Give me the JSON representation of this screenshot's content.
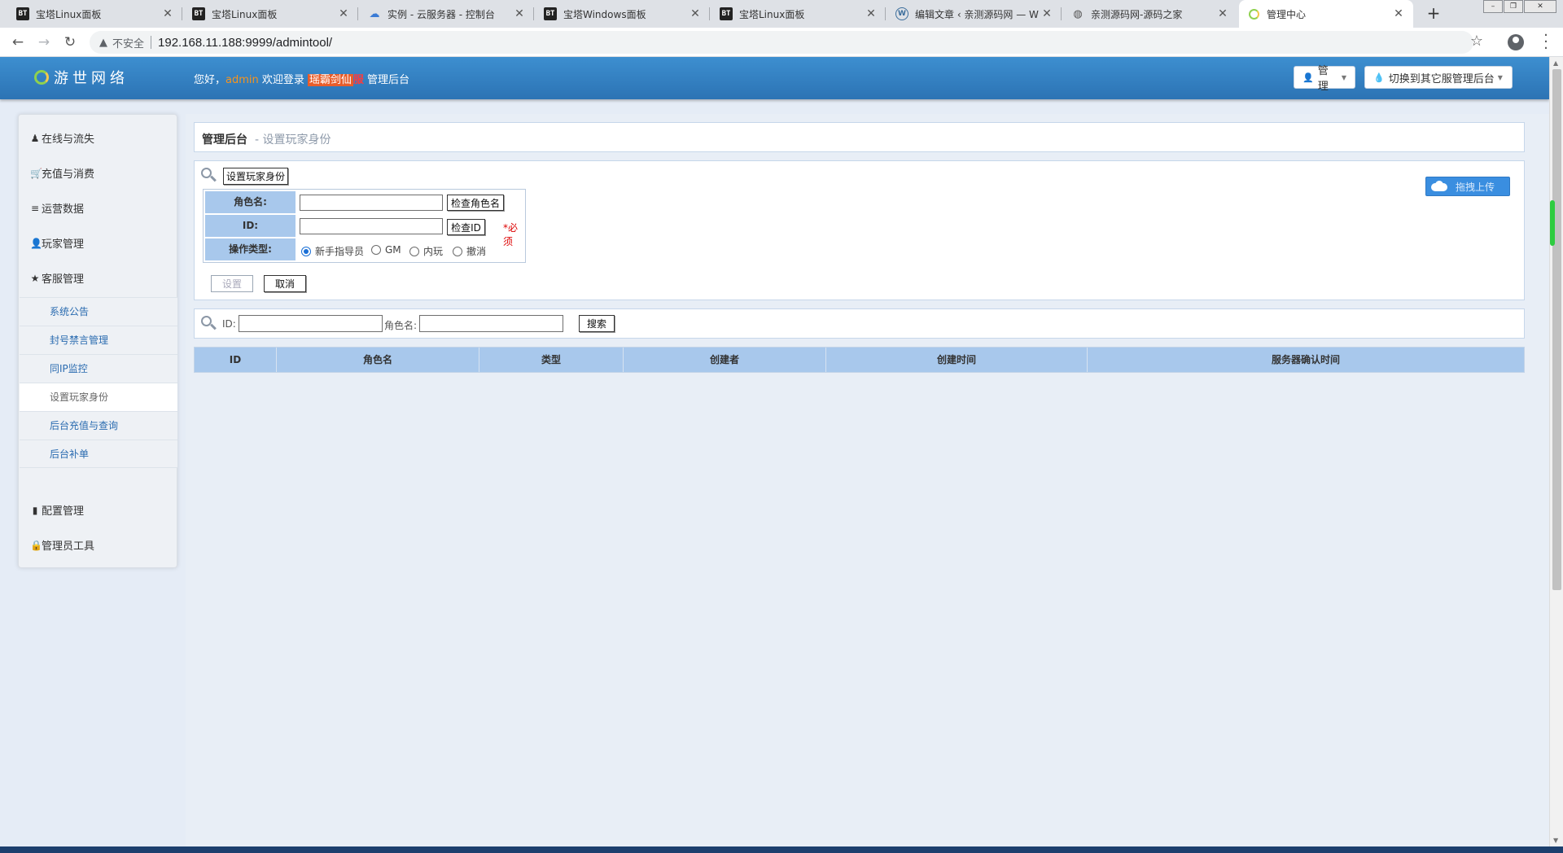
{
  "browser": {
    "tabs": [
      {
        "icon": "BT",
        "title": "宝塔Linux面板"
      },
      {
        "icon": "BT",
        "title": "宝塔Linux面板"
      },
      {
        "icon": "cloud",
        "title": "实例 - 云服务器 - 控制台"
      },
      {
        "icon": "BT",
        "title": "宝塔Windows面板"
      },
      {
        "icon": "BT",
        "title": "宝塔Linux面板"
      },
      {
        "icon": "wordpress",
        "title": "编辑文章 ‹ 亲测源码网 — W"
      },
      {
        "icon": "globe",
        "title": "亲测源码网-源码之家"
      },
      {
        "icon": "loading",
        "title": "管理中心"
      }
    ],
    "security_label": "不安全",
    "url": "192.168.11.188:9999/admintool/"
  },
  "header": {
    "logo": "游世网络",
    "greeting": "您好，",
    "username": "admin",
    "welcome": "欢迎登录",
    "game": "瑶霸剑仙",
    "flag": "服",
    "admin_label": "管理后台",
    "manage_btn": "管理",
    "switch_btn": "切换到其它服管理后台"
  },
  "sidebar": {
    "items": [
      {
        "icon": "♟",
        "label": "在线与流失"
      },
      {
        "icon": "🛒",
        "label": "充值与消费"
      },
      {
        "icon": "≡",
        "label": "运营数据"
      },
      {
        "icon": "👤",
        "label": "玩家管理"
      },
      {
        "icon": "★",
        "label": "客服管理"
      }
    ],
    "sub_items": [
      "系统公告",
      "封号禁言管理",
      "同IP监控",
      "设置玩家身份",
      "后台充值与查询",
      "后台补单"
    ],
    "active_sub": "设置玩家身份",
    "bottom_items": [
      {
        "icon": "▮",
        "label": "配置管理"
      },
      {
        "icon": "🔒",
        "label": "管理员工具"
      }
    ]
  },
  "page": {
    "breadcrumb_main": "管理后台",
    "breadcrumb_sub": "- 设置玩家身份"
  },
  "form": {
    "section_button": "设置玩家身份",
    "role_label": "角色名:",
    "role_value": "",
    "check_role_btn": "检查角色名",
    "id_label": "ID:",
    "id_value": "",
    "check_id_btn": "检查ID",
    "required": "*必须",
    "type_label": "操作类型:",
    "types": [
      "新手指导员",
      "GM",
      "内玩",
      "撤消"
    ],
    "selected_type": "新手指导员",
    "submit_btn": "设置",
    "cancel_btn": "取消",
    "upload_btn": "拖拽上传"
  },
  "search": {
    "id_label": "ID:",
    "role_label": "角色名:",
    "button": "搜索"
  },
  "table": {
    "columns": [
      "ID",
      "角色名",
      "类型",
      "创建者",
      "创建时间",
      "服务器确认时间"
    ],
    "rows": []
  }
}
